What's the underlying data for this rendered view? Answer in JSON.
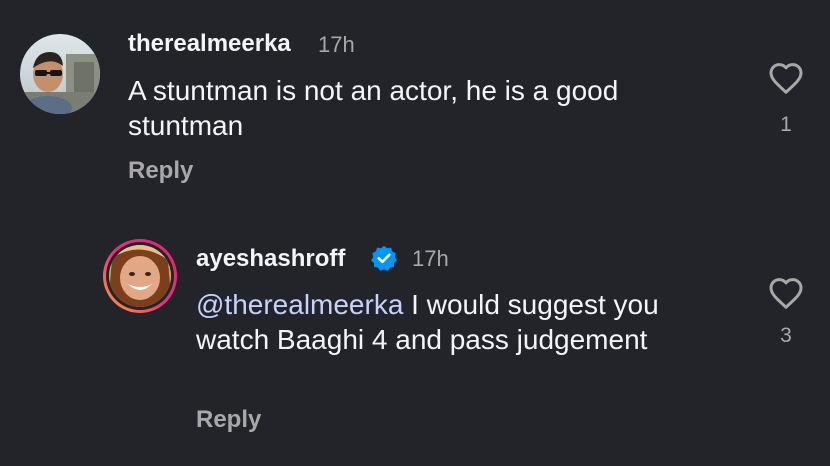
{
  "comments": [
    {
      "username": "therealmeerka",
      "time": "17h",
      "text": "A stuntman is not an actor, he is a good stuntman",
      "reply_label": "Reply",
      "like_count": "1"
    }
  ],
  "replies": [
    {
      "username": "ayeshashroff",
      "verified": true,
      "time": "17h",
      "mention": "@therealmeerka",
      "text": " I would suggest you watch Baaghi 4 and pass judgement",
      "reply_label": "Reply",
      "like_count": "3"
    }
  ],
  "colors": {
    "background": "#222429",
    "text": "#f3f5f7",
    "secondary": "#a8a8a8",
    "mention": "#c7d2fe",
    "verified": "#0095f6",
    "story_ring_start": "#f9a82a",
    "story_ring_end": "#d62976"
  },
  "icons": [
    "heart-icon",
    "verified-badge-icon"
  ]
}
